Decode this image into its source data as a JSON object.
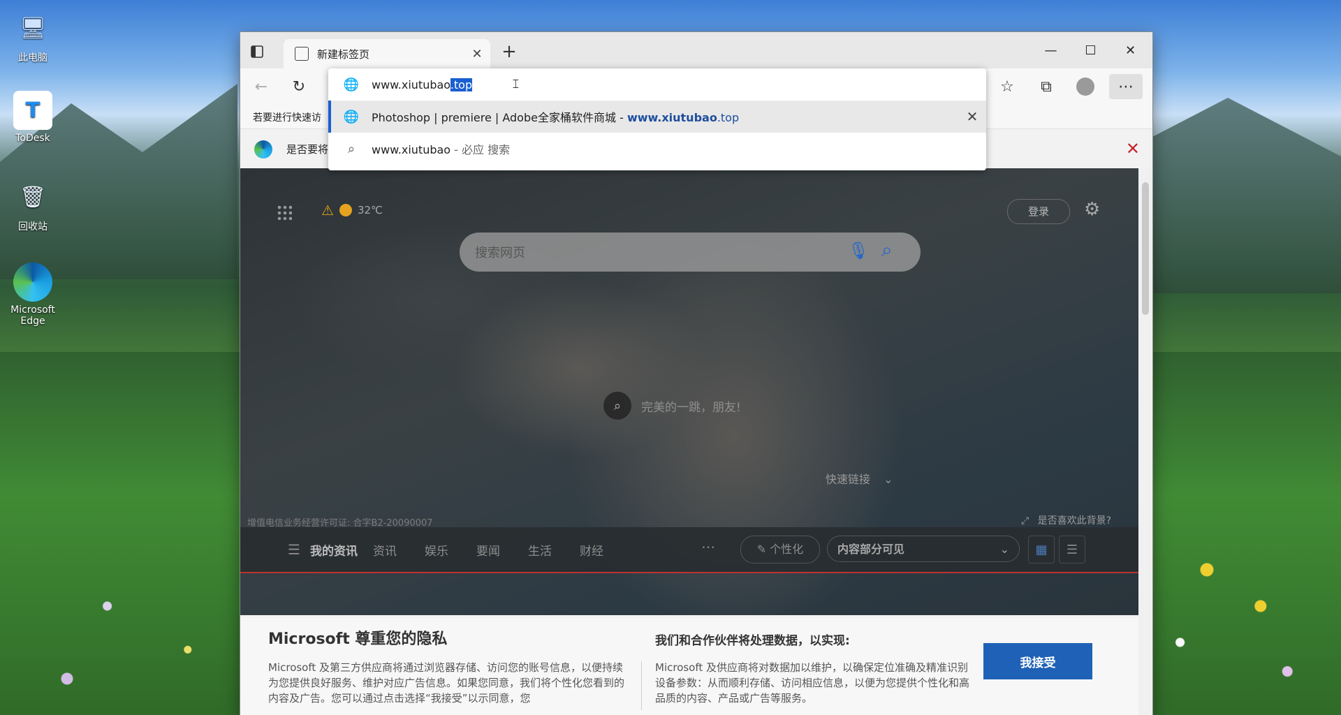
{
  "desktop": {
    "icons": [
      {
        "label": "此电脑"
      },
      {
        "label": "ToDesk"
      },
      {
        "label": "回收站"
      },
      {
        "label": "Microsoft Edge"
      }
    ]
  },
  "browser": {
    "tab": {
      "title": "新建标签页"
    },
    "favorites_bar_text": "若要进行快速访",
    "infobar_text": "是否要将",
    "omnibox": {
      "input_prefix": "www.xiutubao",
      "input_selected": ".top",
      "suggestions": [
        {
          "title": "Photoshop | premiere | Adobe全家桶软件商城",
          "separator": " - ",
          "url_bold": "www.xiutubao",
          "url_rest": ".top"
        },
        {
          "query": "www.xiutubao",
          "suffix": " - 必应 搜索"
        }
      ]
    }
  },
  "ntp": {
    "temperature": "32℃",
    "login_label": "登录",
    "search_placeholder": "搜索网页",
    "image_caption": "完美的一跳，朋友!",
    "quick_links": "快速链接",
    "license_text": "增值电信业务经营许可证: 合字B2-20090007",
    "like_background": "是否喜欢此背景?",
    "news_tabs": [
      "我的资讯",
      "资讯",
      "娱乐",
      "要闻",
      "生活",
      "财经"
    ],
    "personalize_label": "个性化",
    "visibility_label": "内容部分可见"
  },
  "privacy": {
    "title": "Microsoft 尊重您的隐私",
    "body_left": "Microsoft 及第三方供应商将通过浏览器存储、访问您的账号信息，以便持续为您提供良好服务、维护对应广告信息。如果您同意，我们将个性化您看到的内容及广告。您可以通过点击选择“我接受”以示同意，您",
    "subtitle": "我们和合作伙伴将处理数据，以实现:",
    "body_right": "Microsoft 及供应商将对数据加以维护，以确保定位准确及精准识别设备参数：从而顺利存储、访问相应信息，以便为您提供个性化和高品质的内容、产品或广告等服务。",
    "accept_label": "我接受"
  }
}
